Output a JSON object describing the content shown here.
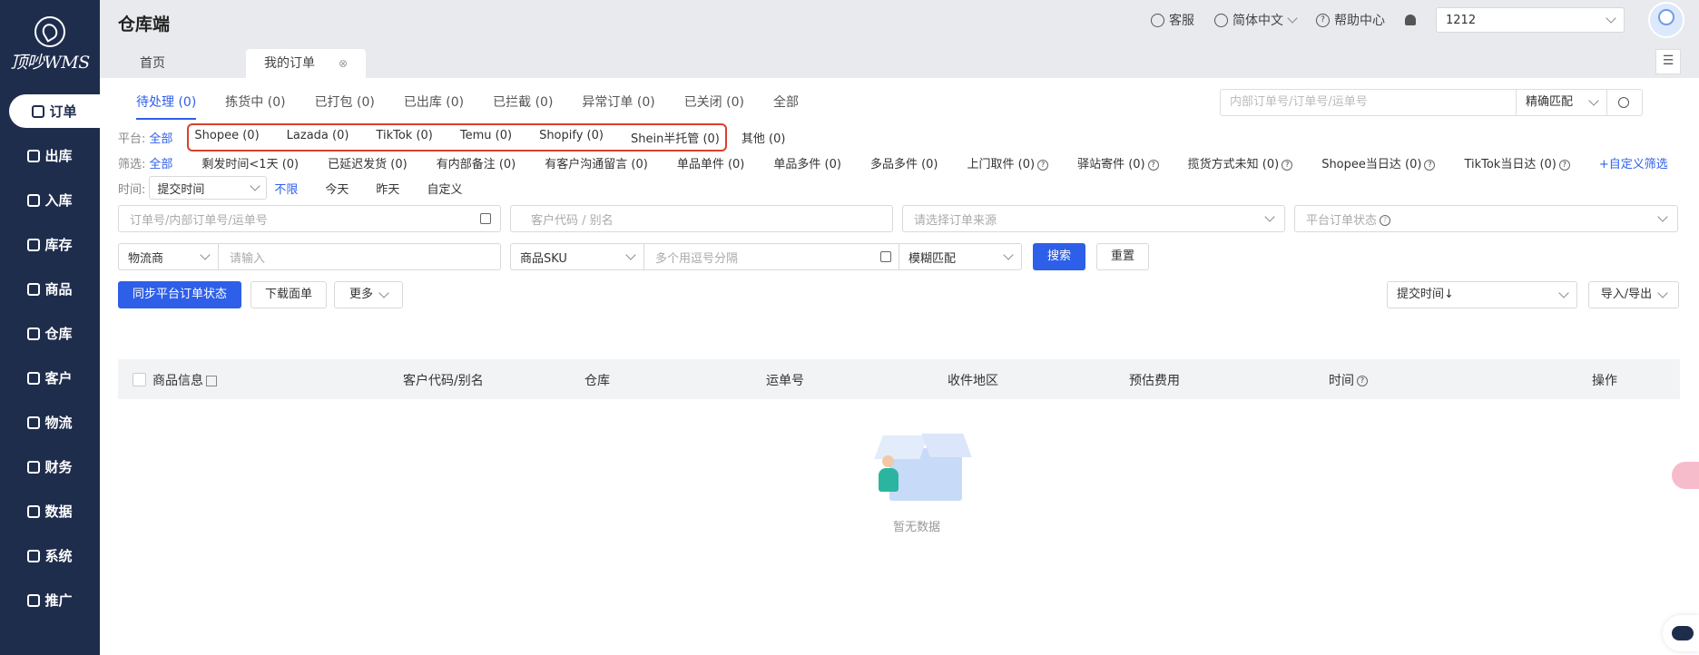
{
  "brand": {
    "logo_text": "顶吵WMS"
  },
  "sidebar": {
    "items": [
      {
        "label": "订单",
        "active": true
      },
      {
        "label": "出库"
      },
      {
        "label": "入库"
      },
      {
        "label": "库存"
      },
      {
        "label": "商品"
      },
      {
        "label": "仓库"
      },
      {
        "label": "客户"
      },
      {
        "label": "物流"
      },
      {
        "label": "财务"
      },
      {
        "label": "数据"
      },
      {
        "label": "系统"
      },
      {
        "label": "推广"
      }
    ]
  },
  "header": {
    "title": "仓库端",
    "service": "客服",
    "language": "简体中文",
    "help": "帮助中心",
    "account_value": "1212"
  },
  "page_tabs": [
    {
      "label": "首页"
    },
    {
      "label": "我的订单"
    }
  ],
  "page_tab_close": "⊗",
  "menu_icon": "☰",
  "status_tabs": [
    "待处理 (0)",
    "拣货中 (0)",
    "已打包 (0)",
    "已出库 (0)",
    "已拦截 (0)",
    "异常订单 (0)",
    "已关闭 (0)",
    "全部"
  ],
  "top_search": {
    "placeholder": "内部订单号/订单号/运单号",
    "match": "精确匹配"
  },
  "platform": {
    "label": "平台:",
    "all": "全部",
    "options": [
      "Shopee (0)",
      "Lazada (0)",
      "TikTok (0)",
      "Temu (0)",
      "Shopify (0)",
      "Shein半托管 (0)"
    ],
    "other": "其他 (0)"
  },
  "filter": {
    "label": "筛选:",
    "all": "全部",
    "options": [
      "剩发时间<1天 (0)",
      "已延迟发货 (0)",
      "有内部备注 (0)",
      "有客户沟通留言 (0)",
      "单品单件 (0)",
      "单品多件 (0)",
      "多品多件 (0)",
      "上门取件 (0)",
      "驿站寄件 (0)",
      "揽货方式未知 (0)",
      "Shopee当日达 (0)",
      "TikTok当日达 (0)"
    ],
    "help_flags": [
      false,
      false,
      false,
      false,
      false,
      false,
      false,
      true,
      true,
      true,
      true,
      true
    ],
    "custom": "+自定义筛选"
  },
  "time": {
    "label": "时间:",
    "select": "提交时间",
    "options": [
      "不限",
      "今天",
      "昨天",
      "自定义"
    ]
  },
  "form": {
    "order_no": "订单号/内部订单号/运单号",
    "customer_code": "客户代码 / 别名",
    "order_source": "请选择订单来源",
    "platform_status": "平台订单状态",
    "carrier": "物流商",
    "carrier_input": "请输入",
    "sku_select": "商品SKU",
    "sku_input": "多个用逗号分隔",
    "fuzzy": "模糊匹配",
    "search": "搜索",
    "reset": "重置"
  },
  "actions": {
    "sync": "同步平台订单状态",
    "download": "下载面单",
    "more": "更多",
    "sort": "提交时间↓",
    "import_export": "导入/导出"
  },
  "table": {
    "columns": [
      "商品信息",
      "客户代码/别名",
      "仓库",
      "运单号",
      "收件地区",
      "预估费用",
      "时间",
      "操作"
    ]
  },
  "empty_text": "暂无数据"
}
